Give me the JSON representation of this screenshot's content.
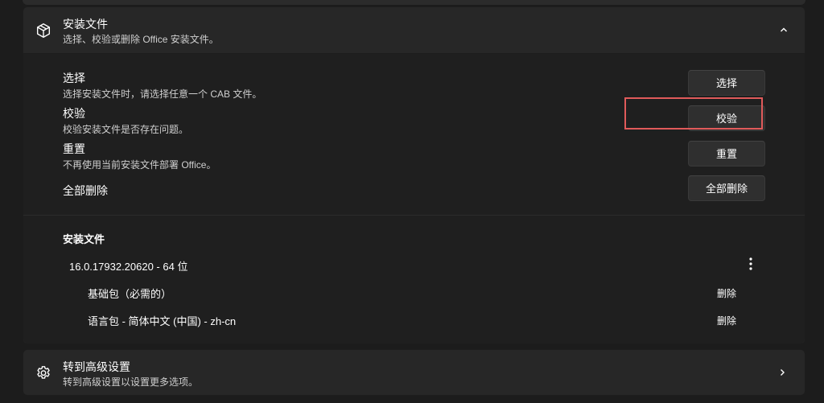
{
  "install_files": {
    "title": "安装文件",
    "subtitle": "选择、校验或删除 Office 安装文件。",
    "header_icon": "package-icon",
    "collapse_icon": "chevron-up-icon",
    "rows": [
      {
        "title": "选择",
        "desc": "选择安装文件时，请选择任意一个 CAB 文件。",
        "button": "选择"
      },
      {
        "title": "校验",
        "desc": "校验安装文件是否存在问题。",
        "button": "校验"
      },
      {
        "title": "重置",
        "desc": "不再使用当前安装文件部署 Office。",
        "button": "重置"
      },
      {
        "title": "全部删除",
        "desc": "",
        "button": "全部删除"
      }
    ],
    "highlight_color": "#e05a5a",
    "files_section": {
      "title": "安装文件",
      "version": "16.0.17932.20620 - 64 位",
      "more_icon": "more-vertical-icon",
      "packages": [
        {
          "name": "基础包（必需的）",
          "action": "删除"
        },
        {
          "name": "语言包 - 简体中文 (中国) - zh-cn",
          "action": "删除"
        }
      ]
    }
  },
  "advanced": {
    "title": "转到高级设置",
    "subtitle": "转到高级设置以设置更多选项。",
    "icon": "gear-icon",
    "chevron": "chevron-right-icon"
  }
}
